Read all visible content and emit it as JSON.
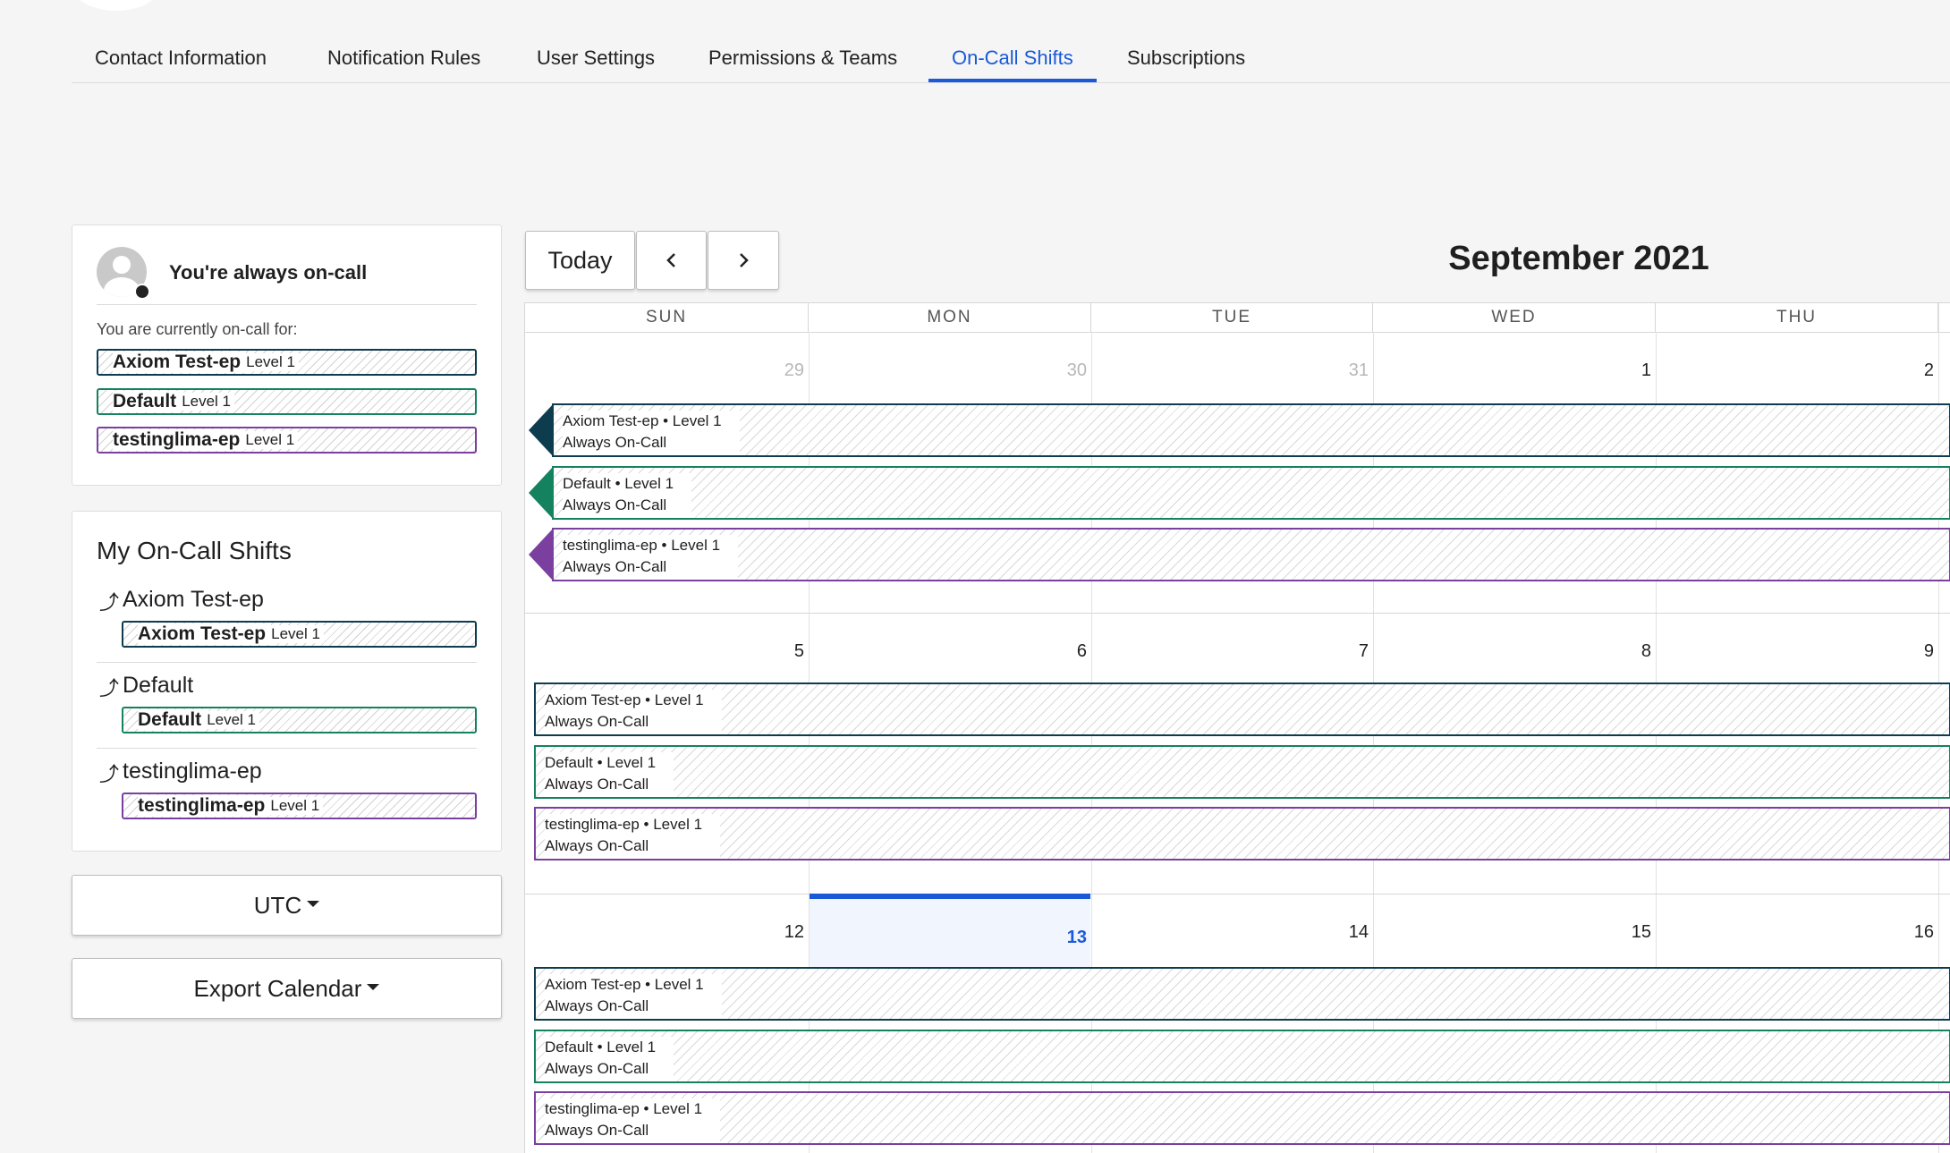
{
  "tabs": [
    {
      "label": "Contact Information"
    },
    {
      "label": "Notification Rules"
    },
    {
      "label": "User Settings"
    },
    {
      "label": "Permissions & Teams"
    },
    {
      "label": "On-Call Shifts"
    },
    {
      "label": "Subscriptions"
    }
  ],
  "active_tab": "On-Call Shifts",
  "status": {
    "title": "You're always on-call",
    "subtitle": "You are currently on-call for:",
    "policies": [
      {
        "name": "Axiom Test-ep",
        "level": "Level 1",
        "color": "#0d3c4f"
      },
      {
        "name": "Default",
        "level": "Level 1",
        "color": "#15825f"
      },
      {
        "name": "testinglima-ep",
        "level": "Level 1",
        "color": "#7b3fa0"
      }
    ]
  },
  "my_shifts": {
    "title": "My On-Call Shifts",
    "groups": [
      {
        "name": "Axiom Test-ep",
        "pill_name": "Axiom Test-ep",
        "level": "Level 1"
      },
      {
        "name": "Default",
        "pill_name": "Default",
        "level": "Level 1"
      },
      {
        "name": "testinglima-ep",
        "pill_name": "testinglima-ep",
        "level": "Level 1"
      }
    ]
  },
  "timezone_button": "UTC",
  "export_button": "Export Calendar",
  "calendar": {
    "today_label": "Today",
    "prev_icon": "chevron-left-icon",
    "next_icon": "chevron-right-icon",
    "month_title": "September 2021",
    "day_headers": [
      "SUN",
      "MON",
      "TUE",
      "WED",
      "THU"
    ],
    "weeks": [
      [
        "29",
        "30",
        "31",
        "1",
        "2"
      ],
      [
        "5",
        "6",
        "7",
        "8",
        "9"
      ],
      [
        "12",
        "13",
        "14",
        "15",
        "16"
      ]
    ],
    "today": "13",
    "events": [
      {
        "title": "Axiom Test-ep • Level 1",
        "subtitle": "Always On-Call",
        "color": "#0d3c4f"
      },
      {
        "title": "Default • Level 1",
        "subtitle": "Always On-Call",
        "color": "#15825f"
      },
      {
        "title": "testinglima-ep • Level 1",
        "subtitle": "Always On-Call",
        "color": "#7b3fa0"
      }
    ]
  }
}
